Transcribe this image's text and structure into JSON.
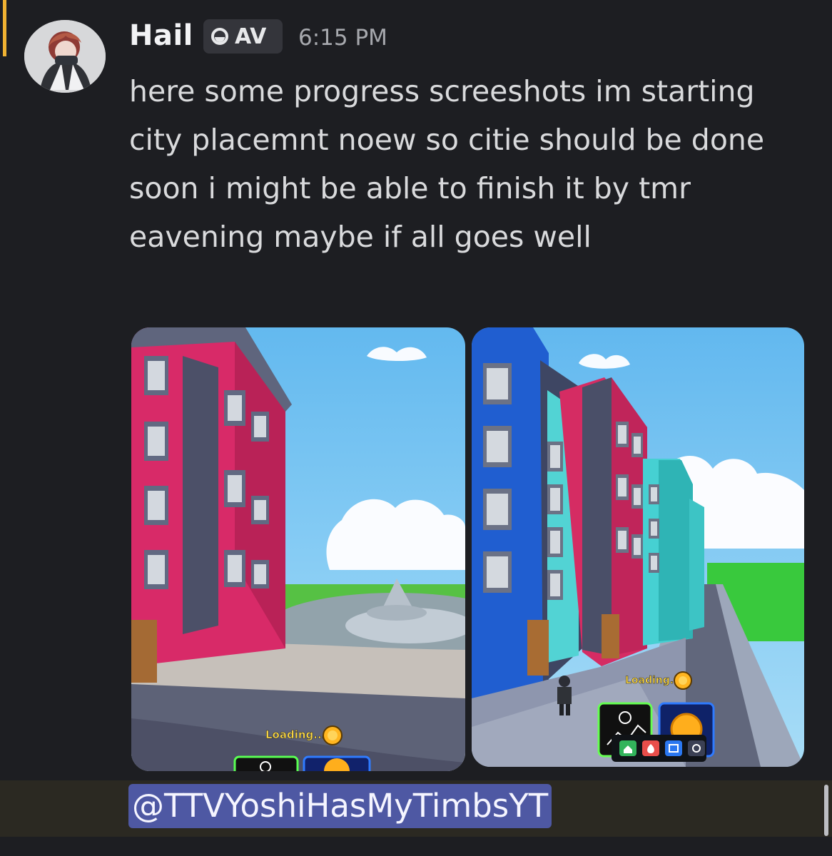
{
  "message": {
    "author": "Hail",
    "tag": "AV",
    "timestamp": "6:15 PM",
    "text": "here some progress screeshots im starting city placemnt noew so citie should be done soon i might be able to finish it by tmr eavening maybe if all goes well"
  },
  "attachments": [
    {
      "hud": {
        "loading_text": "Loading..."
      }
    },
    {
      "hud": {
        "loading_text": "Loading..."
      }
    }
  ],
  "mention": "@TTVYoshiHasMyTimbsYT",
  "icons": {
    "avatar": "avatar",
    "tag": "clan-badge-icon",
    "coin": "coin-icon",
    "shop": "money-chart-icon",
    "home": "home-icon",
    "fire": "fire-icon",
    "image": "image-icon",
    "settings": "gear-icon"
  },
  "colors": {
    "background": "#1d1e22",
    "mention_bg": "#4e58a3",
    "reply_accent": "#f0b232"
  }
}
